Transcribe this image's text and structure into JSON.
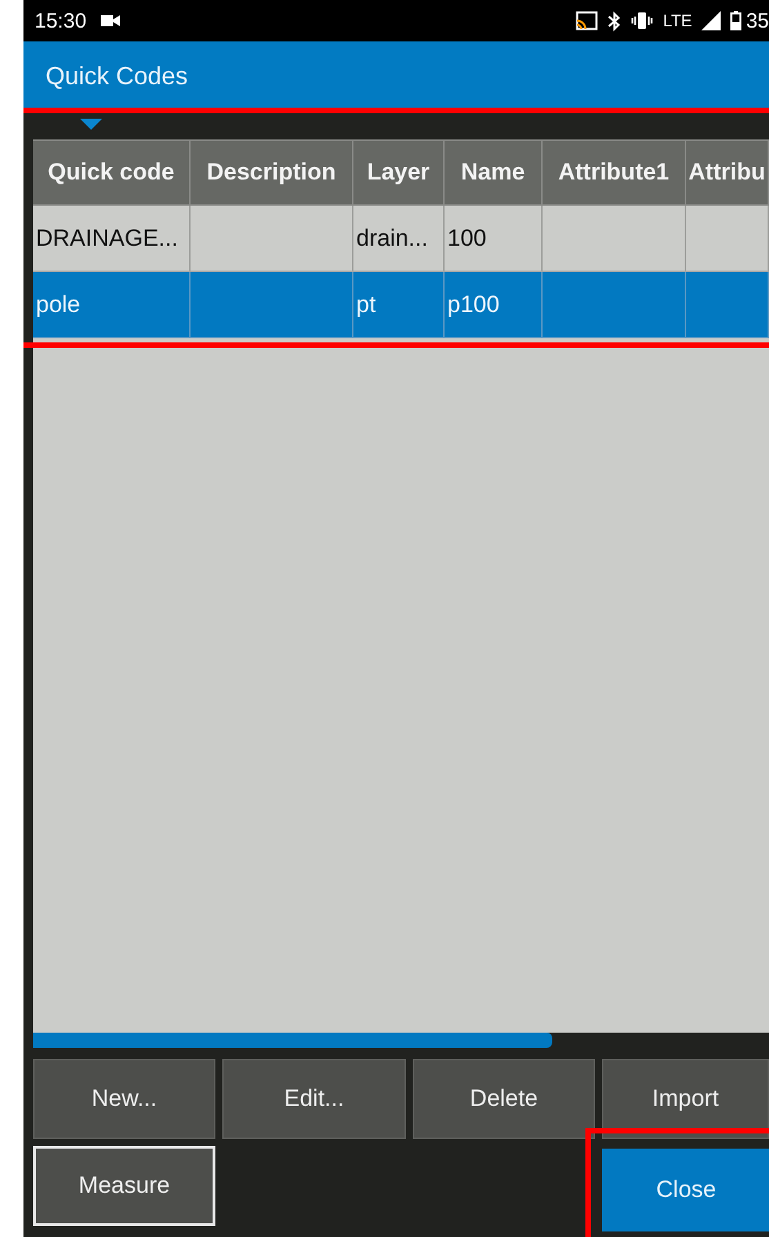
{
  "status_bar": {
    "time": "15:30",
    "network": "LTE",
    "battery": "35"
  },
  "app_bar": {
    "title": "Quick Codes"
  },
  "table": {
    "highlighted": true,
    "columns": [
      "Quick code",
      "Description",
      "Layer",
      "Name",
      "Attribute1",
      "Attribu"
    ],
    "rows": [
      {
        "cells": [
          "DRAINAGE...",
          "",
          "drain...",
          "100",
          "",
          ""
        ],
        "selected": false
      },
      {
        "cells": [
          "pole",
          "",
          "pt",
          "p100",
          "",
          ""
        ],
        "selected": true
      }
    ]
  },
  "buttons": [
    {
      "label": "New...",
      "focused": false,
      "highlighted": false,
      "kind": "plain"
    },
    {
      "label": "Edit...",
      "focused": false,
      "highlighted": false,
      "kind": "plain"
    },
    {
      "label": "Delete",
      "focused": false,
      "highlighted": false,
      "kind": "plain"
    },
    {
      "label": "Import",
      "focused": false,
      "highlighted": false,
      "kind": "plain"
    },
    {
      "label": "Measure",
      "focused": true,
      "highlighted": false,
      "kind": "plain"
    },
    {
      "label": "Close",
      "focused": false,
      "highlighted": true,
      "kind": "primary"
    }
  ]
}
